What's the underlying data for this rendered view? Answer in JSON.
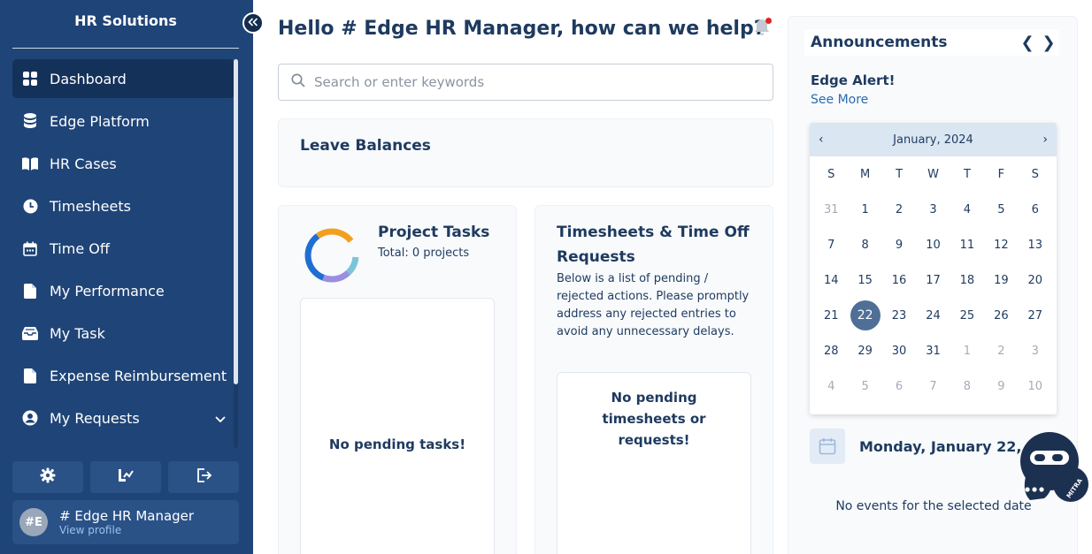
{
  "sidebar": {
    "brand": "HR Solutions",
    "items": [
      {
        "label": "Dashboard",
        "icon": "dashboard-icon"
      },
      {
        "label": "Edge Platform",
        "icon": "database-icon"
      },
      {
        "label": "HR Cases",
        "icon": "book-icon"
      },
      {
        "label": "Timesheets",
        "icon": "clock-icon"
      },
      {
        "label": "Time Off",
        "icon": "calendar-icon"
      },
      {
        "label": "My Performance",
        "icon": "document-icon"
      },
      {
        "label": "My Task",
        "icon": "inbox-icon"
      },
      {
        "label": "Expense Reimbursement",
        "icon": "document-icon"
      },
      {
        "label": "My Requests",
        "icon": "user-circle-icon"
      }
    ],
    "profile": {
      "initials": "#E",
      "name": "# Edge HR Manager",
      "link": "View profile"
    }
  },
  "main": {
    "greeting": "Hello # Edge HR Manager, how can we help?",
    "search": {
      "placeholder": "Search or enter keywords",
      "value": ""
    },
    "leave": {
      "title": "Leave Balances"
    },
    "projects": {
      "title": "Project Tasks",
      "subtitle": "Total: 0 projects",
      "empty": "No pending tasks!"
    },
    "timesheets": {
      "title": "Timesheets & Time Off Requests",
      "description": "Below is a list of pending / rejected actions. Please promptly address any rejected entries to avoid any unnecessary delays.",
      "empty": "No pending timesheets or requests!"
    }
  },
  "right": {
    "announcements": {
      "title": "Announcements",
      "prev": "❮",
      "next": "❯"
    },
    "alert": {
      "title": "Edge Alert!",
      "link": "See More"
    },
    "calendar": {
      "month": "January, 2024",
      "prev": "‹",
      "next": "›",
      "weekdays": [
        "S",
        "M",
        "T",
        "W",
        "T",
        "F",
        "S"
      ],
      "days": [
        {
          "d": "31",
          "m": true
        },
        {
          "d": "1"
        },
        {
          "d": "2"
        },
        {
          "d": "3"
        },
        {
          "d": "4"
        },
        {
          "d": "5"
        },
        {
          "d": "6"
        },
        {
          "d": "7"
        },
        {
          "d": "8"
        },
        {
          "d": "9"
        },
        {
          "d": "10"
        },
        {
          "d": "11"
        },
        {
          "d": "12"
        },
        {
          "d": "13"
        },
        {
          "d": "14"
        },
        {
          "d": "15"
        },
        {
          "d": "16"
        },
        {
          "d": "17"
        },
        {
          "d": "18"
        },
        {
          "d": "19"
        },
        {
          "d": "20"
        },
        {
          "d": "21"
        },
        {
          "d": "22",
          "s": true
        },
        {
          "d": "23"
        },
        {
          "d": "24"
        },
        {
          "d": "25"
        },
        {
          "d": "26"
        },
        {
          "d": "27"
        },
        {
          "d": "28"
        },
        {
          "d": "29"
        },
        {
          "d": "30"
        },
        {
          "d": "31"
        },
        {
          "d": "1",
          "m": true
        },
        {
          "d": "2",
          "m": true
        },
        {
          "d": "3",
          "m": true
        },
        {
          "d": "4",
          "m": true
        },
        {
          "d": "5",
          "m": true
        },
        {
          "d": "6",
          "m": true
        },
        {
          "d": "7",
          "m": true
        },
        {
          "d": "8",
          "m": true
        },
        {
          "d": "9",
          "m": true
        },
        {
          "d": "10",
          "m": true
        }
      ]
    },
    "selected_date": "Monday, January 22, 2024",
    "no_events": "No events for the selected date",
    "assistant_badge": "MITRA"
  },
  "colors": {
    "sidebar_bg": "#1f4477",
    "sidebar_active": "#14315a",
    "text_primary": "#1e3a5f",
    "link": "#2b6cb0",
    "calendar_selected": "#4f6f97",
    "notification_dot": "#e02424"
  }
}
